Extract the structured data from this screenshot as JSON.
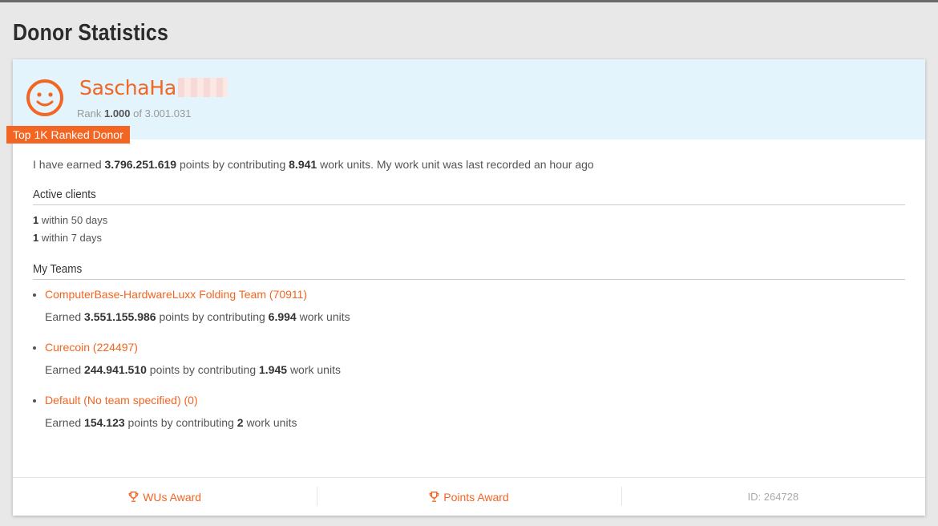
{
  "page": {
    "title": "Donor Statistics"
  },
  "donor": {
    "name": "SaschaHa",
    "rank_prefix": "Rank",
    "rank": "1.000",
    "rank_of": "of 3.001.031",
    "badge": "Top 1K Ranked Donor"
  },
  "summary": {
    "part1": "I have earned",
    "points": "3.796.251.619",
    "part2": "points by contributing",
    "wus": "8.941",
    "part3": "work units. My work unit was last recorded an hour ago"
  },
  "clients": {
    "heading": "Active clients",
    "rows": [
      {
        "count": "1",
        "label": "within 50 days"
      },
      {
        "count": "1",
        "label": "within 7 days"
      }
    ]
  },
  "teams": {
    "heading": "My Teams",
    "items": [
      {
        "name": "ComputerBase-HardwareLuxx Folding Team (70911)",
        "earned": "Earned",
        "points": "3.551.155.986",
        "mid": "points by contributing",
        "wus": "6.994",
        "tail": "work units"
      },
      {
        "name": "Curecoin (224497)",
        "earned": "Earned",
        "points": "244.941.510",
        "mid": "points by contributing",
        "wus": "1.945",
        "tail": "work units"
      },
      {
        "name": "Default (No team specified) (0)",
        "earned": "Earned",
        "points": "154.123",
        "mid": "points by contributing",
        "wus": "2",
        "tail": "work units"
      }
    ]
  },
  "footer": {
    "wus_award": "WUs Award",
    "points_award": "Points Award",
    "id": "ID: 264728"
  },
  "colors": {
    "accent": "#f26522",
    "header_bg": "#e3f4fc",
    "page_bg": "#e8e8e8"
  },
  "icons": [
    "smiley-avatar-icon",
    "trophy-icon"
  ]
}
